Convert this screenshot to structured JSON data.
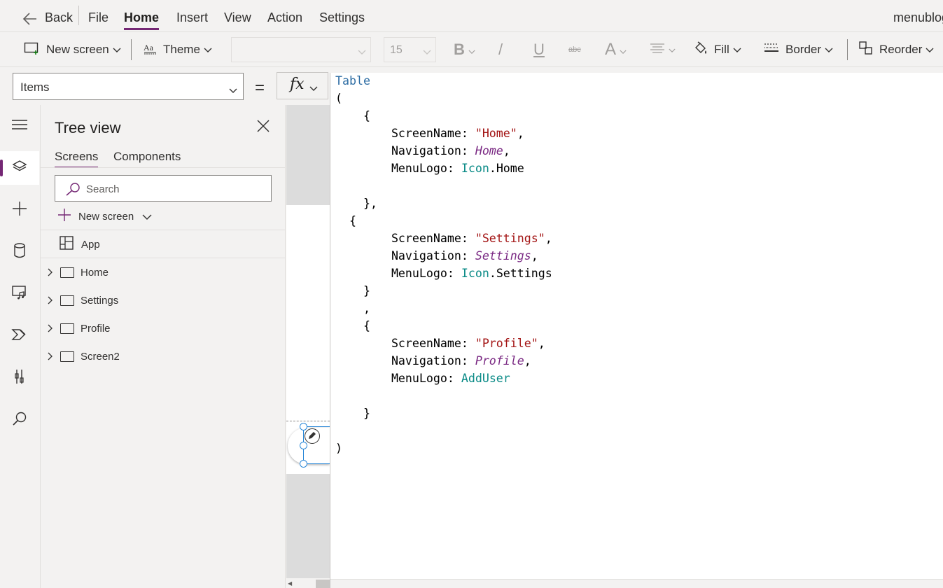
{
  "menubar": {
    "back_label": "Back",
    "items": [
      "File",
      "Home",
      "Insert",
      "View",
      "Action",
      "Settings"
    ],
    "active_item": "Home",
    "app_name": "menublog"
  },
  "toolbar": {
    "new_screen_label": "New screen",
    "theme_label": "Theme",
    "font_value": "",
    "font_size_value": "15",
    "bold_glyph": "B",
    "italic_glyph": "/",
    "underline_glyph": "U",
    "strike_glyph": "abc",
    "font_color_glyph": "A",
    "fill_label": "Fill",
    "border_label": "Border",
    "reorder_label": "Reorder"
  },
  "formula_bar": {
    "property_value": "Items",
    "equals": "=",
    "fx_label": "fx"
  },
  "tree_view": {
    "title": "Tree view",
    "tabs": [
      "Screens",
      "Components"
    ],
    "active_tab": "Screens",
    "search_placeholder": "Search",
    "new_screen_label": "New screen",
    "app_label": "App",
    "screens": [
      "Home",
      "Settings",
      "Profile",
      "Screen2"
    ]
  },
  "editor": {
    "table_fn": "Table",
    "open_paren": "(",
    "close_paren": ")",
    "field_screen_name": "ScreenName",
    "field_navigation": "Navigation",
    "field_menu_logo": "MenuLogo",
    "records": [
      {
        "screen_name": "\"Home\"",
        "navigation": "Home",
        "logo_enum": "Icon",
        "logo_member": ".Home"
      },
      {
        "screen_name": "\"Settings\"",
        "navigation": "Settings",
        "logo_enum": "Icon",
        "logo_member": ".Settings"
      },
      {
        "screen_name": "\"Profile\"",
        "navigation": "Profile",
        "logo_enum": "AddUser",
        "logo_member": ""
      }
    ]
  },
  "colors": {
    "accent": "#742774",
    "string": "#a31515",
    "navigation": "#7b2b84",
    "enum": "#098a86",
    "function": "#2e6da4",
    "selection": "#2b88d8"
  }
}
